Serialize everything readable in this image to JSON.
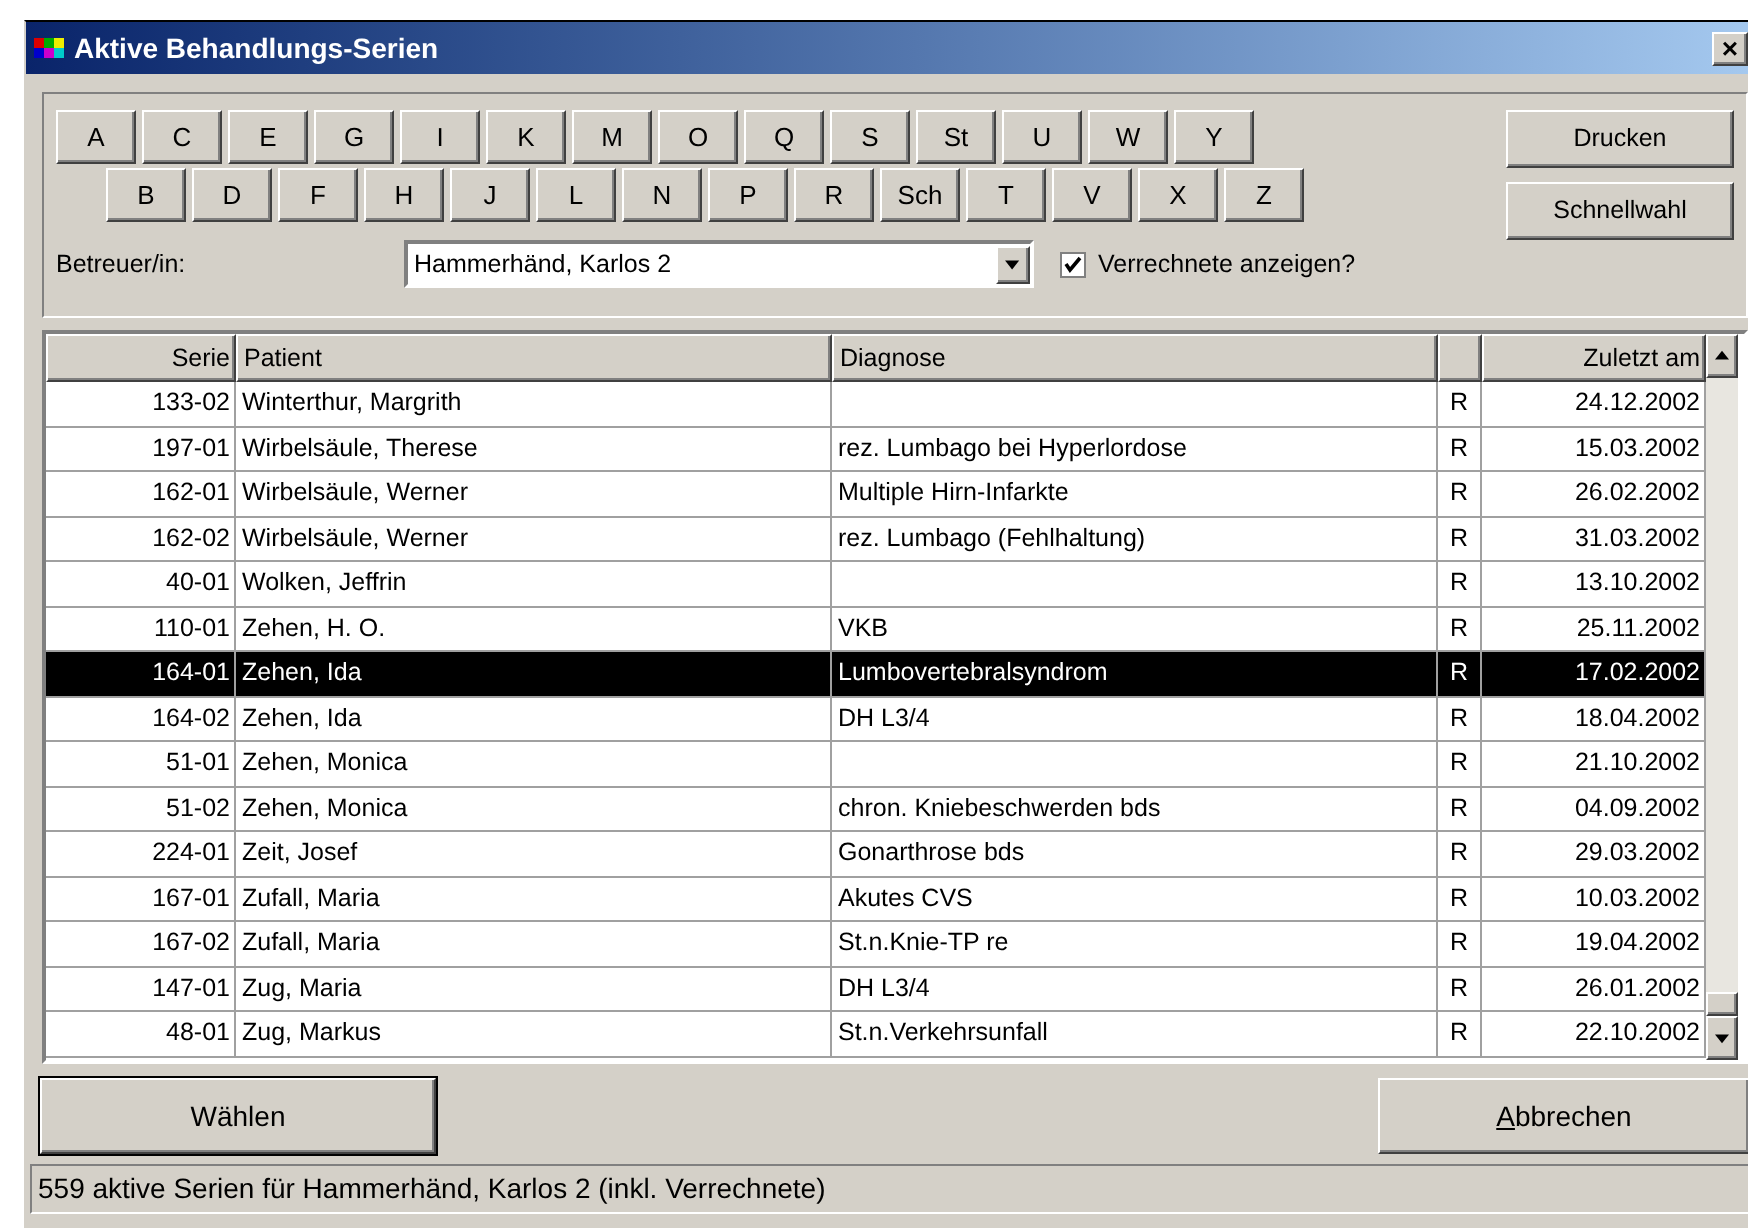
{
  "window": {
    "title": "Aktive Behandlungs-Serien",
    "close": "×"
  },
  "letters_row_1": [
    "A",
    "C",
    "E",
    "G",
    "I",
    "K",
    "M",
    "O",
    "Q",
    "S",
    "St",
    "U",
    "W",
    "Y"
  ],
  "letters_row_2": [
    "B",
    "D",
    "F",
    "H",
    "J",
    "L",
    "N",
    "P",
    "R",
    "Sch",
    "T",
    "V",
    "X",
    "Z"
  ],
  "side_buttons": [
    "Drucken",
    "Schnellwahl"
  ],
  "caretaker": {
    "label": "Betreuer/in:",
    "value": "Hammerhänd, Karlos 2"
  },
  "show_billed": {
    "label": "Verrechnete anzeigen?",
    "checked": true
  },
  "table": {
    "columns": [
      "Serie",
      "Patient",
      "Diagnose",
      "",
      "Zuletzt am"
    ],
    "rows": [
      {
        "serie": "133-02",
        "patient": "Winterthur, Margrith",
        "diagnose": "",
        "flag": "R",
        "date": "24.12.2002",
        "selected": false
      },
      {
        "serie": "197-01",
        "patient": "Wirbelsäule, Therese",
        "diagnose": "rez. Lumbago bei Hyperlordose",
        "flag": "R",
        "date": "15.03.2002",
        "selected": false
      },
      {
        "serie": "162-01",
        "patient": "Wirbelsäule, Werner",
        "diagnose": "Multiple Hirn-Infarkte",
        "flag": "R",
        "date": "26.02.2002",
        "selected": false
      },
      {
        "serie": "162-02",
        "patient": "Wirbelsäule, Werner",
        "diagnose": "rez. Lumbago (Fehlhaltung)",
        "flag": "R",
        "date": "31.03.2002",
        "selected": false
      },
      {
        "serie": "40-01",
        "patient": "Wolken, Jeffrin",
        "diagnose": "",
        "flag": "R",
        "date": "13.10.2002",
        "selected": false
      },
      {
        "serie": "110-01",
        "patient": "Zehen, H. O.",
        "diagnose": "VKB",
        "flag": "R",
        "date": "25.11.2002",
        "selected": false
      },
      {
        "serie": "164-01",
        "patient": "Zehen, Ida",
        "diagnose": "Lumbovertebralsyndrom",
        "flag": "R",
        "date": "17.02.2002",
        "selected": true
      },
      {
        "serie": "164-02",
        "patient": "Zehen, Ida",
        "diagnose": "DH L3/4",
        "flag": "R",
        "date": "18.04.2002",
        "selected": false
      },
      {
        "serie": "51-01",
        "patient": "Zehen, Monica",
        "diagnose": "",
        "flag": "R",
        "date": "21.10.2002",
        "selected": false
      },
      {
        "serie": "51-02",
        "patient": "Zehen, Monica",
        "diagnose": "chron. Kniebeschwerden bds",
        "flag": "R",
        "date": "04.09.2002",
        "selected": false
      },
      {
        "serie": "224-01",
        "patient": "Zeit, Josef",
        "diagnose": "Gonarthrose bds",
        "flag": "R",
        "date": "29.03.2002",
        "selected": false
      },
      {
        "serie": "167-01",
        "patient": "Zufall, Maria",
        "diagnose": "Akutes CVS",
        "flag": "R",
        "date": "10.03.2002",
        "selected": false
      },
      {
        "serie": "167-02",
        "patient": "Zufall, Maria",
        "diagnose": "St.n.Knie-TP re",
        "flag": "R",
        "date": "19.04.2002",
        "selected": false
      },
      {
        "serie": "147-01",
        "patient": "Zug, Maria",
        "diagnose": "DH L3/4",
        "flag": "R",
        "date": "26.01.2002",
        "selected": false
      },
      {
        "serie": "48-01",
        "patient": "Zug, Markus",
        "diagnose": "St.n.Verkehrsunfall",
        "flag": "R",
        "date": "22.10.2002",
        "selected": false
      }
    ]
  },
  "buttons": [
    {
      "label": "Wählen",
      "default": true,
      "mnemonic": false
    },
    {
      "label": "Abbrechen",
      "default": false,
      "mnemonic": true
    }
  ],
  "status_bar": "559 aktive Serien für Hammerhänd, Karlos 2 (inkl. Verrechnete)"
}
